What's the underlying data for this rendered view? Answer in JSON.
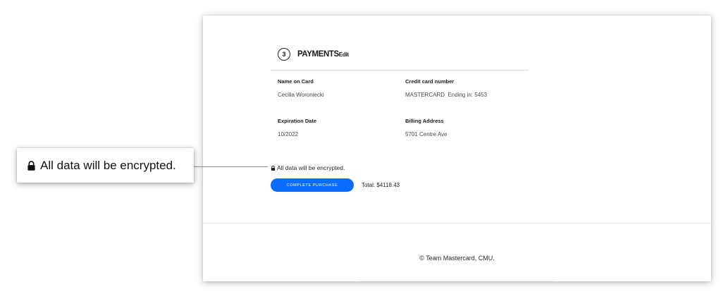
{
  "payment": {
    "step_number": "3",
    "title": "PAYMENTS",
    "edit_label": "Edit",
    "fields": {
      "name_label": "Name on Card",
      "name_value": "Cecilia Woroniecki",
      "cc_label": "Credit card number",
      "cc_value": "MASTERCARD  Ending in: 5453",
      "exp_label": "Expiration Date",
      "exp_value": "10/2022",
      "billing_label": "Billing Address",
      "billing_value": "5701 Centre Ave"
    },
    "encryption_note": "All data will be encrypted.",
    "complete_button": "COMPLETE PURCHASE",
    "total": "Total: $4118.43",
    "accent_color": "#0a6cff"
  },
  "footer": {
    "text": "© Team Mastercard, CMU."
  },
  "callout": {
    "text": "All data will be encrypted.",
    "icon": "lock-icon"
  }
}
